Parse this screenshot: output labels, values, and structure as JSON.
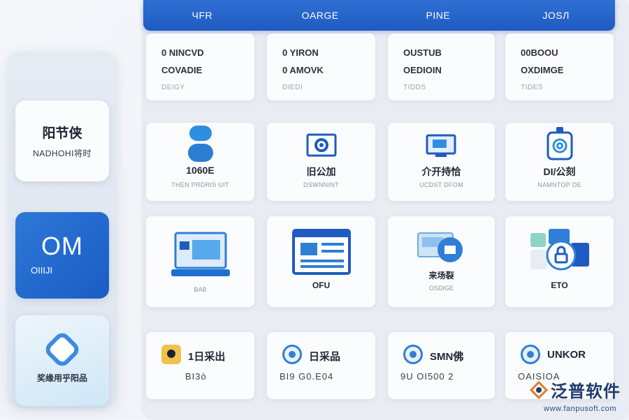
{
  "tabs": [
    "ЧFR",
    "OARGE",
    "PINE",
    "JOSЛ"
  ],
  "sidebar": {
    "card1": {
      "line1": "阳节侠",
      "line2": "NADHOHI将时"
    },
    "card2": {
      "line1": "OM",
      "line2": "OIIIJI"
    },
    "card3": {
      "line1": "奖缘用乎阳品"
    }
  },
  "row1": [
    {
      "l1": "0 NINCVD",
      "l2": "COVADIE",
      "l3": "DEIGY"
    },
    {
      "l1": "0 YIRON",
      "l2": "0 AMOVK",
      "l3": "DIEDI"
    },
    {
      "l1": "OUSTUB",
      "l2": "OEDIOIN",
      "l3": "TIDDS"
    },
    {
      "l1": "00BOOU",
      "l2": "OXDIMGE",
      "l3": "TIDES"
    }
  ],
  "row2": [
    {
      "label": "1060E",
      "sub": "THEN PRDRIS UIT"
    },
    {
      "label": "旧公加",
      "sub": "DSWNNINT"
    },
    {
      "label": "介开持恰",
      "sub": "UCDST DFOM"
    },
    {
      "label": "DI/公刻",
      "sub": "NAMNTOP DE"
    }
  ],
  "row3": [
    {
      "label": "",
      "sub": "BAB"
    },
    {
      "label": "OFU",
      "sub": ""
    },
    {
      "label": "来场裂",
      "sub": "OSDIGE"
    },
    {
      "label": "ETO",
      "sub": ""
    }
  ],
  "row4": [
    {
      "head": "1日采出",
      "num": "ВI3ò"
    },
    {
      "head": "日采品",
      "num": "BI9 G0.E04"
    },
    {
      "head": "SMN佛",
      "num": "9U OI500 2"
    },
    {
      "head": "UNKOR",
      "num": "OAISIOA"
    }
  ],
  "logo": {
    "text": "泛普软件",
    "url": "www.fanpusoft.com"
  },
  "colors": {
    "accent": "#1f5bc2",
    "accent_light": "#2f7fd6",
    "yellow": "#f0c24a"
  }
}
